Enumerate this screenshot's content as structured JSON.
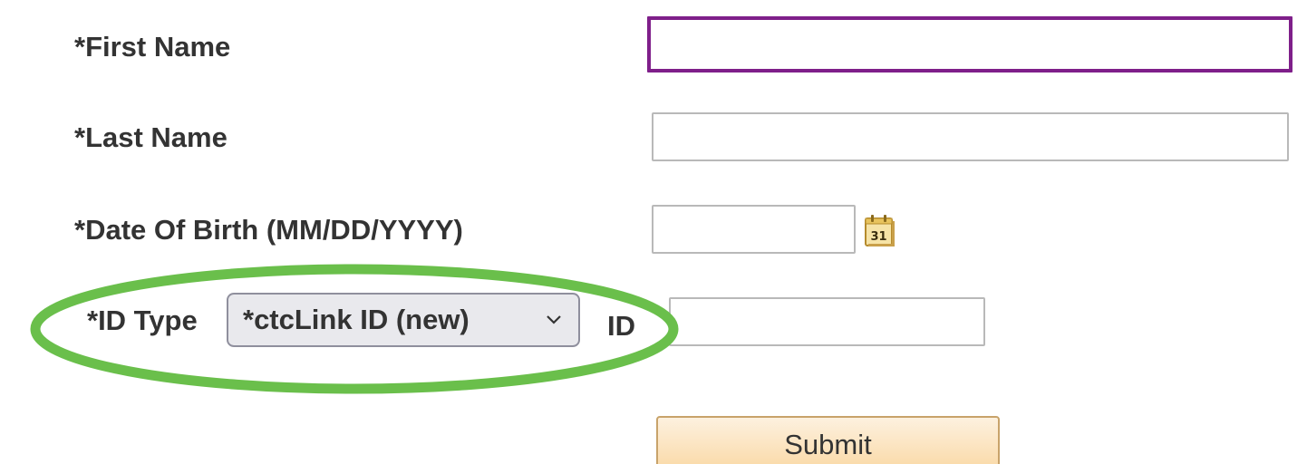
{
  "form": {
    "first_name": {
      "label": "*First Name",
      "value": ""
    },
    "last_name": {
      "label": "*Last Name",
      "value": ""
    },
    "date_of_birth": {
      "label": "*Date Of Birth (MM/DD/YYYY)",
      "value": "",
      "calendar_day": "31",
      "calendar_icon": "calendar-icon"
    },
    "id_type": {
      "label": "*ID Type",
      "selected": "*ctcLink ID (new)",
      "chevron_icon": "chevron-down-icon"
    },
    "id": {
      "label": "ID",
      "value": ""
    },
    "submit_label": "Submit"
  },
  "colors": {
    "label_text": "#333333",
    "focus_border": "#7f1f8a",
    "input_border": "#b9b9b9",
    "highlight_ring": "#6abf4b",
    "submit_bg_top": "#fdf1df",
    "submit_bg_bottom": "#fad8a4"
  }
}
